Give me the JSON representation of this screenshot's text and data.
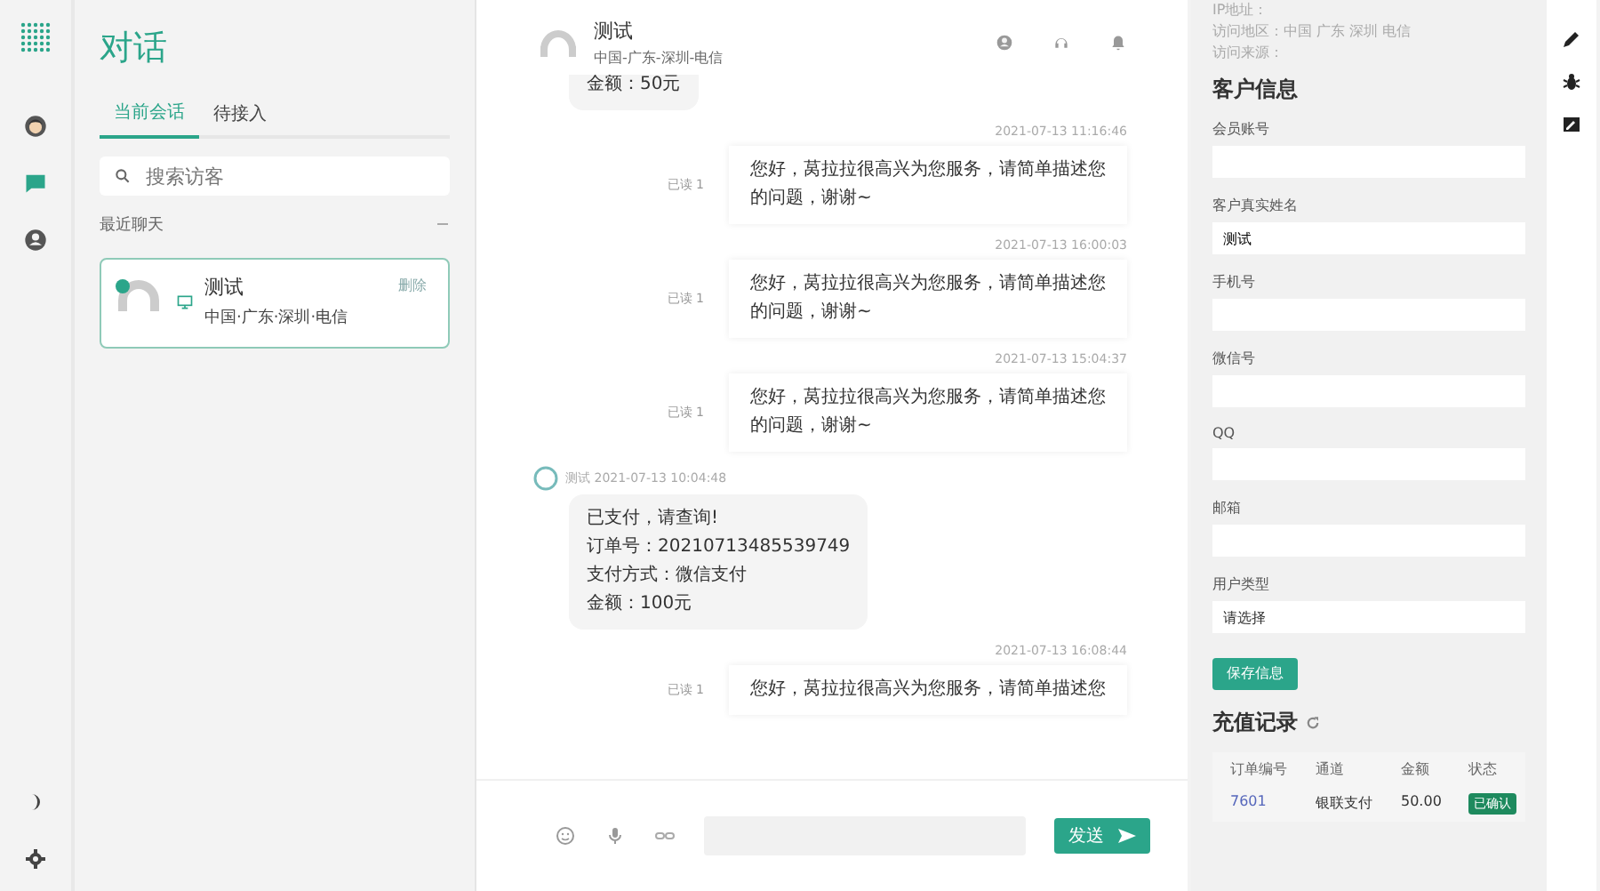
{
  "rail": {
    "items": [
      {
        "kind": "avatar",
        "selected": false
      },
      {
        "kind": "chat",
        "selected": true
      },
      {
        "kind": "user",
        "selected": false
      }
    ],
    "bottom": [
      {
        "kind": "moon"
      },
      {
        "kind": "gear"
      }
    ]
  },
  "sidebar": {
    "title": "对话",
    "tabs": [
      {
        "label": "当前会话",
        "selected": true
      },
      {
        "label": "待接入",
        "selected": false
      }
    ],
    "search": {
      "placeholder": "搜索访客"
    },
    "section": "最近聊天",
    "expanded": true,
    "conversations": [
      {
        "name": "测试",
        "location": "中国·广东·深圳·电信",
        "action": "删除",
        "online": true,
        "selected": true
      }
    ]
  },
  "chat": {
    "header": {
      "name": "测试",
      "location": "中国-广东-深圳-电信"
    },
    "messages": [
      {
        "kind": "visitor",
        "lines": [
          "金额：50元"
        ],
        "cut": true
      },
      {
        "kind": "agent",
        "time": "2021-07-13 11:16:46",
        "status": "已读 1",
        "text": "您好，莴拉拉很高兴为您服务，请简单描述您的问题，谢谢~"
      },
      {
        "kind": "agent",
        "time": "2021-07-13 16:00:03",
        "status": "已读 1",
        "text": "您好，莴拉拉很高兴为您服务，请简单描述您的问题，谢谢~"
      },
      {
        "kind": "agent",
        "time": "2021-07-13 15:04:37",
        "status": "已读 1",
        "text": "您好，莴拉拉很高兴为您服务，请简单描述您的问题，谢谢~"
      },
      {
        "kind": "visitor",
        "sender": "测试",
        "time": "2021-07-13 10:04:48",
        "lines": [
          "已支付，请查询!",
          "订单号：20210713485539749",
          "支付方式：微信支付",
          "金额：100元"
        ]
      },
      {
        "kind": "agent",
        "time": "2021-07-13 16:08:44",
        "status": "已读 1",
        "text": "您好，莴拉拉很高兴为您服务，请简单描述您"
      }
    ],
    "send": "发送"
  },
  "visit": {
    "lines": [
      "IP地址：",
      "访问地区：中国 广东 深圳 电信",
      "访问来源："
    ]
  },
  "customer": {
    "title": "客户信息",
    "fields": [
      {
        "kind": "input",
        "label": "会员账号"
      },
      {
        "kind": "input",
        "label": "客户真实姓名",
        "value": "测试"
      },
      {
        "kind": "input",
        "label": "手机号"
      },
      {
        "kind": "input",
        "label": "微信号"
      },
      {
        "kind": "input",
        "label": "QQ"
      },
      {
        "kind": "input",
        "label": "邮箱"
      },
      {
        "kind": "select",
        "label": "用户类型",
        "value": "请选择"
      }
    ],
    "save": "保存信息"
  },
  "recharge": {
    "title": "充值记录",
    "columns": [
      "订单编号",
      "通道",
      "金额",
      "状态"
    ],
    "rows": [
      {
        "id": "7601",
        "channel": "银联支付",
        "amount": "50.00",
        "status": "已确认"
      }
    ]
  }
}
